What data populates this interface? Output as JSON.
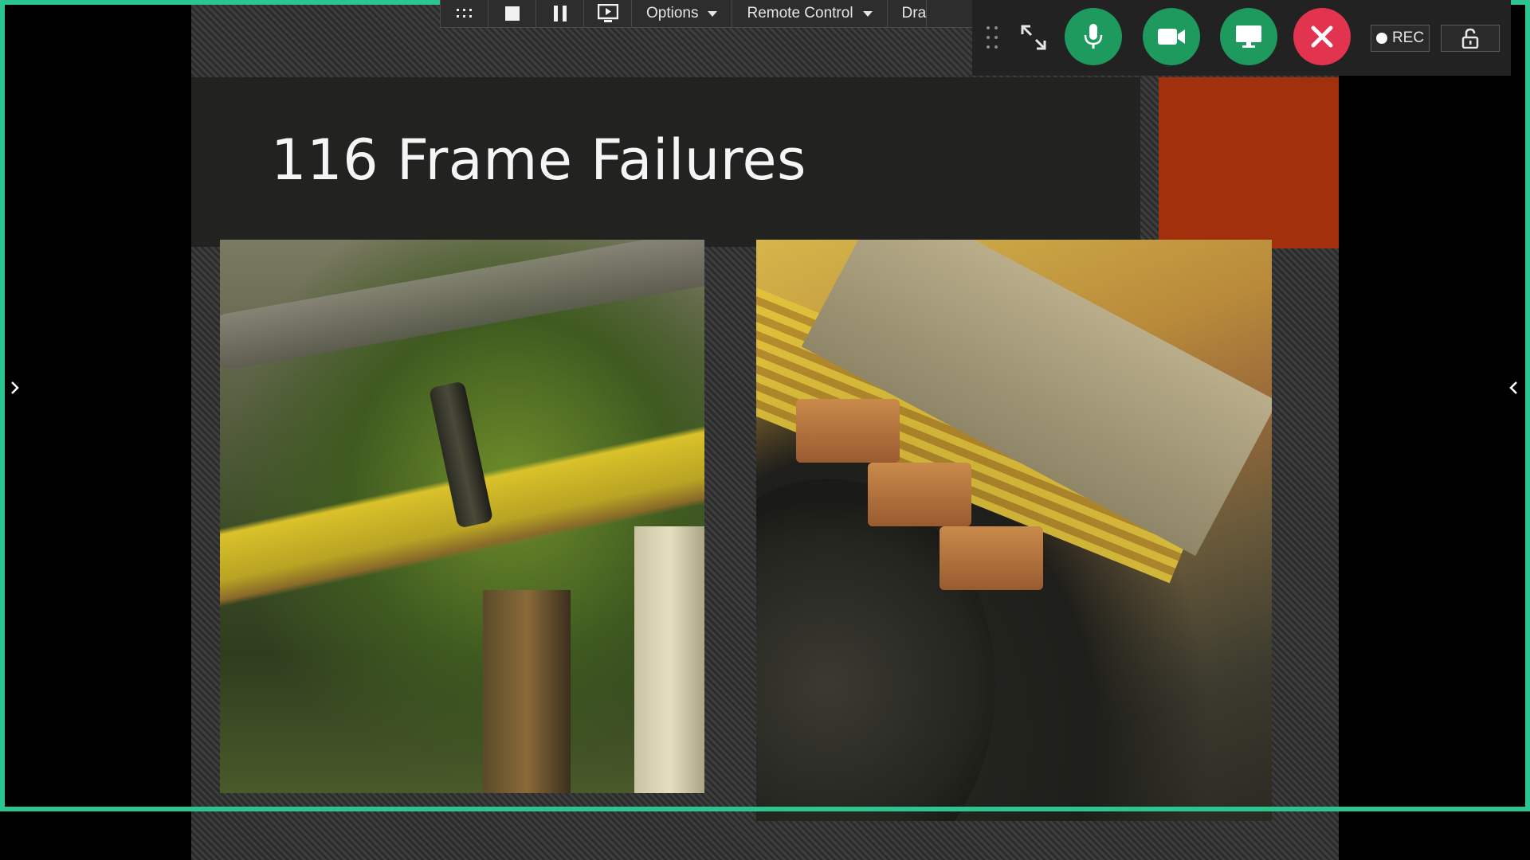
{
  "toolbar": {
    "options_label": "Options",
    "remote_control_label": "Remote Control",
    "draw_label_partial": "Dra"
  },
  "call_controls": {
    "rec_label": "REC",
    "accent_green": "#1f9a5e",
    "accent_red": "#e2334f"
  },
  "share_border_color": "#2cc58f",
  "slide": {
    "title": "116 Frame Failures",
    "accent_color": "#a3300c"
  }
}
